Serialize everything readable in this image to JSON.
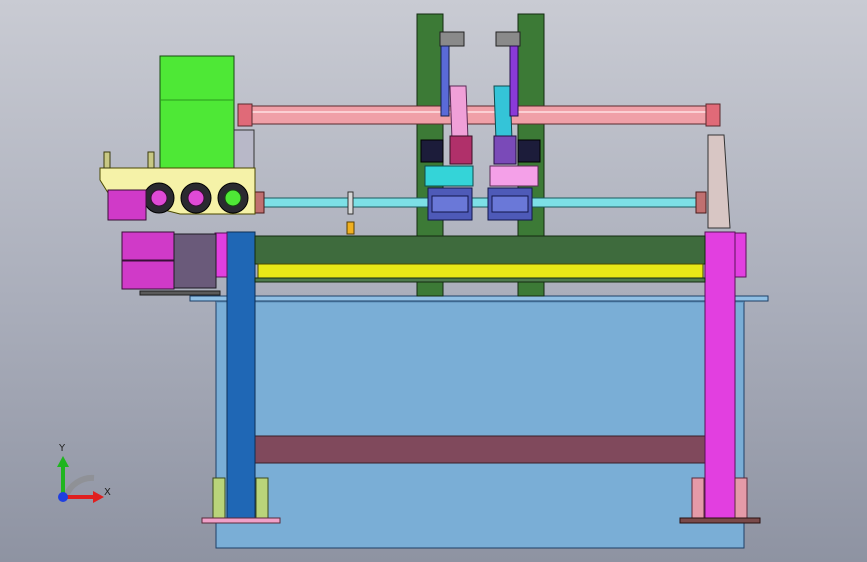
{
  "viewport": {
    "background_top": "#c9cbd3",
    "background_bottom": "#8e93a2"
  },
  "model": {
    "parts": {
      "tank": "#7aaed6",
      "frame_column_left": "#1f67b5",
      "frame_column_right": "#e23fe0",
      "crossbeam": "#3e6b3d",
      "yellow_bar": "#e8e817",
      "lower_beam": "#80495c",
      "top_rod": "#f0a0a8",
      "shaft": "#7de0e6",
      "motor_housing": "#4ee836",
      "gear_plate": "#f5f2a8",
      "motor_body": "#e04ad6",
      "vertical_arm": "#3c7a36"
    }
  },
  "triad": {
    "x_label": "X",
    "y_label": "Y",
    "x_color": "#e01f1f",
    "y_color": "#1fb51f",
    "z_color": "#1f3fe0"
  }
}
